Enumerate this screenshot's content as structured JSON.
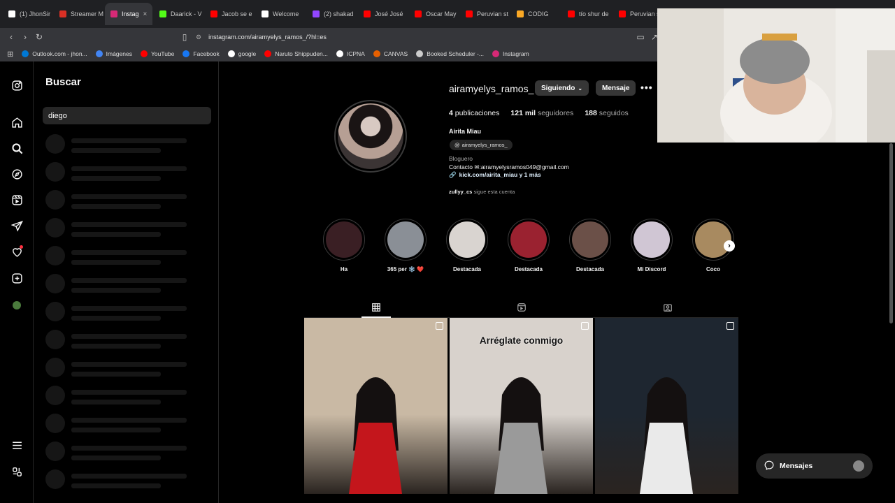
{
  "browser": {
    "tabs": [
      {
        "label": "(1) JhonSir",
        "color": "#ffffff",
        "icon": "x-icon"
      },
      {
        "label": "Streamer M",
        "color": "#d93025",
        "icon": "u-icon"
      },
      {
        "label": "Instag",
        "color": "#d62976",
        "icon": "instagram-icon",
        "active": true
      },
      {
        "label": "Daarick - V",
        "color": "#53fc18",
        "icon": "kick-icon"
      },
      {
        "label": "Jacob se e",
        "color": "#ff0000",
        "icon": "youtube-icon"
      },
      {
        "label": "Welcome",
        "color": "#ffffff",
        "icon": "mm-icon"
      },
      {
        "label": "(2) shakad",
        "color": "#9146ff",
        "icon": "twitch-icon"
      },
      {
        "label": "José José",
        "color": "#ff0000",
        "icon": "youtube-icon"
      },
      {
        "label": "Oscar May",
        "color": "#ff0000",
        "icon": "youtube-icon"
      },
      {
        "label": "Peruvian st",
        "color": "#ff0000",
        "icon": "youtube-icon"
      },
      {
        "label": "CODIG",
        "color": "#f9a825",
        "icon": "codig-icon"
      },
      {
        "label": "tío shur de",
        "color": "#ff0000",
        "icon": "youtube-icon"
      },
      {
        "label": "Peruvian st",
        "color": "#ff0000",
        "icon": "youtube-icon"
      }
    ],
    "tab_close": "×",
    "url": "instagram.com/airamyelys_ramos_/?hl=es",
    "bookmarks": [
      {
        "label": "Outlook.com - jhon...",
        "color": "#0078d4"
      },
      {
        "label": "Imágenes",
        "color": "#4285f4"
      },
      {
        "label": "YouTube",
        "color": "#ff0000"
      },
      {
        "label": "Facebook",
        "color": "#1877f2"
      },
      {
        "label": "google",
        "color": "#ffffff"
      },
      {
        "label": "Naruto Shippuden...",
        "color": "#ff0000"
      },
      {
        "label": "ICPNA",
        "color": "#ffffff"
      },
      {
        "label": "CANVAS",
        "color": "#e66000"
      },
      {
        "label": "Booked Scheduler -...",
        "color": "#cccccc"
      },
      {
        "label": "Instagram",
        "color": "#d62976"
      }
    ]
  },
  "search": {
    "title": "Buscar",
    "query": "diego",
    "skeleton_rows": 13
  },
  "profile": {
    "username": "airamyelys_ramos_",
    "following_button": "Siguiendo",
    "message_button": "Mensaje",
    "posts_count": "4",
    "posts_label": "publicaciones",
    "followers_count": "121 mil",
    "followers_label": "seguidores",
    "following_count": "188",
    "following_label": "seguidos",
    "full_name": "Airita Miau",
    "threads_handle": "airamyelys_ramos_",
    "category": "Bloguero",
    "contact_prefix": "Contacto",
    "contact_email": ":airamyelysramos049@gmail.com",
    "link": "kick.com/airita_miau y 1 más",
    "followed_by_user": "zullyy_cs",
    "followed_by_text": "sigue esta cuenta"
  },
  "highlights": [
    {
      "label": "Ha",
      "color": "#3a1f24"
    },
    {
      "label": "365 per ❄️ ❤️",
      "color": "#8a8f96"
    },
    {
      "label": "Destacada",
      "color": "#d9d4d0"
    },
    {
      "label": "Destacada",
      "color": "#9a2230"
    },
    {
      "label": "Destacada",
      "color": "#6b5048"
    },
    {
      "label": "Mi Discord",
      "color": "#d0c6d4"
    },
    {
      "label": "Coco",
      "color": "#a88a60"
    }
  ],
  "posts": [
    {
      "caption": "",
      "bg": "#c9b9a4",
      "accent": "#c4161c"
    },
    {
      "caption": "Arréglate conmigo",
      "bg": "#d8d2cc",
      "accent": "#9a9a9a"
    },
    {
      "caption": "",
      "bg": "#1e2630",
      "accent": "#eaeaea"
    }
  ],
  "messages_pill": "Mensajes"
}
